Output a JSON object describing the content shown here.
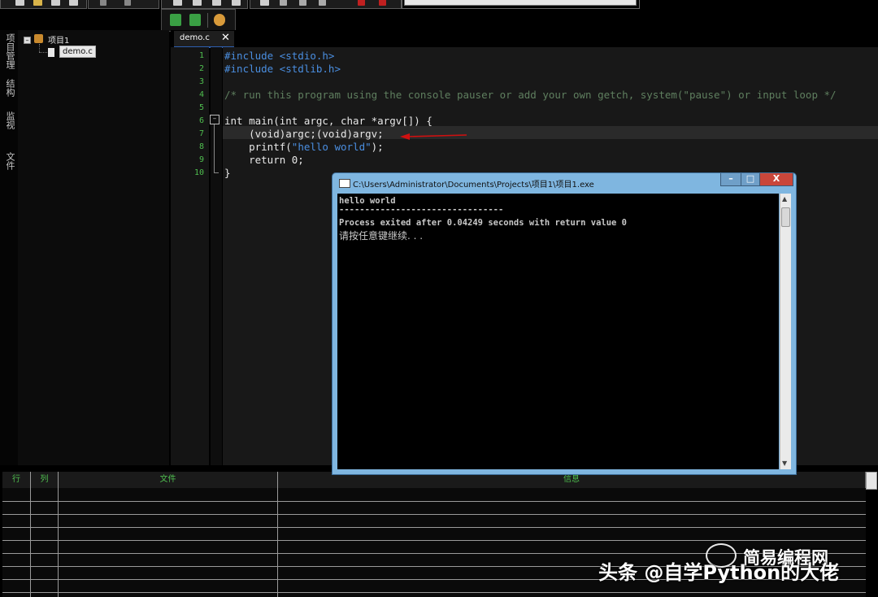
{
  "colors": {
    "line_numbers": "#4fbf4f",
    "preprocessor": "#4a8ee0",
    "comment": "#5f7f5f",
    "arrow": "#d01010",
    "console_frame": "#7fb6e0"
  },
  "sidebar": {
    "tabs": [
      "项目管理",
      "结构",
      "监视",
      "文件"
    ],
    "tree": {
      "project_label": "项目1",
      "file_label": "demo.c",
      "project_icon": "project-icon",
      "file_icon": "file-icon"
    }
  },
  "editor": {
    "tab_label": "demo.c",
    "close_glyph": "✕",
    "line_numbers": [
      "1",
      "2",
      "3",
      "4",
      "5",
      "6",
      "7",
      "8",
      "9",
      "10"
    ]
  },
  "console_window": {
    "title": "C:\\Users\\Administrator\\Documents\\Projects\\项目1\\项目1.exe",
    "buttons": {
      "minimize": "–",
      "maximize": "□",
      "close": "X"
    },
    "lines": [
      "hello world",
      "--------------------------------",
      "Process exited after 0.04249 seconds with return value 0",
      "请按任意键继续. . ."
    ]
  },
  "bottom_panel": {
    "headers": {
      "row": "行",
      "col": "列",
      "file": "文件",
      "info": "信息"
    }
  },
  "watermark": {
    "top_text": "简易编程网",
    "bottom_text": "头条 @自学Python的大佬"
  }
}
